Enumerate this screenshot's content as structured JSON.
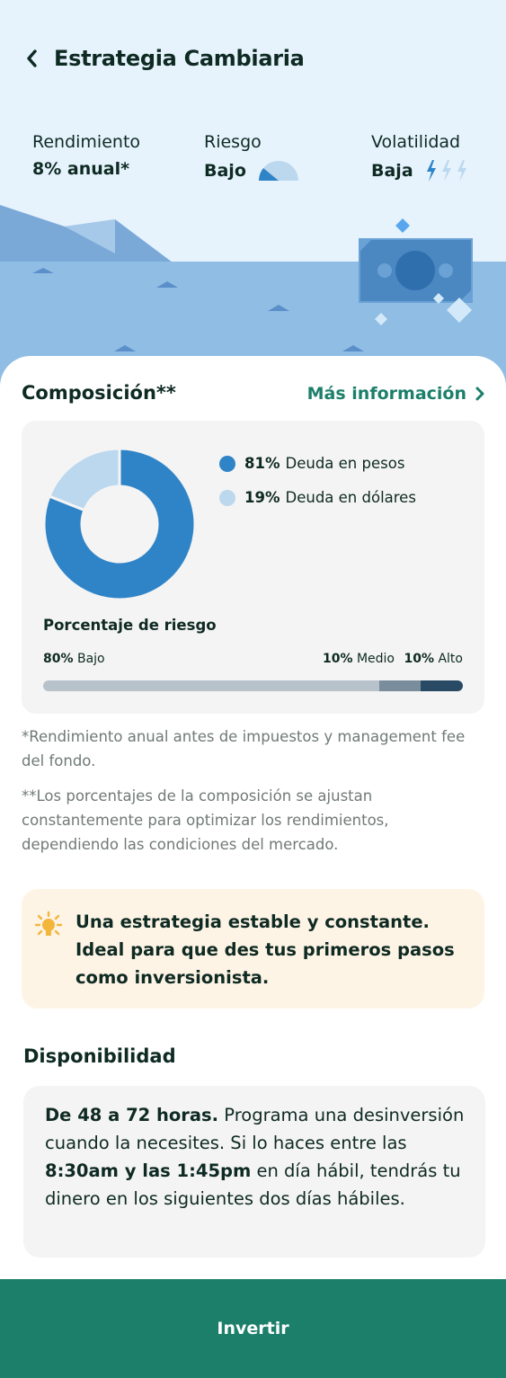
{
  "header": {
    "title": "Estrategia Cambiaria",
    "back_icon": "chevron-left-icon"
  },
  "stats": {
    "rendimiento": {
      "label": "Rendimiento",
      "value": "8% anual*"
    },
    "riesgo": {
      "label": "Riesgo",
      "value": "Bajo",
      "icon": "gauge-icon",
      "level": 0.33
    },
    "volatilidad": {
      "label": "Volatilidad",
      "value": "Baja",
      "icon": "lightning-icon",
      "level": "1 of 3"
    }
  },
  "composition": {
    "title": "Composición**",
    "more_info": "Más información",
    "more_icon": "chevron-right-icon",
    "items": [
      {
        "pct": "81%",
        "label": "Deuda en pesos",
        "value": 81,
        "color": "#2f84c8"
      },
      {
        "pct": "19%",
        "label": "Deuda en dólares",
        "value": 19,
        "color": "#bcd8ee"
      }
    ],
    "risk": {
      "title": "Porcentaje de riesgo",
      "low": {
        "pct": "80%",
        "label": "Bajo",
        "value": 80,
        "color": "#b7c2cb"
      },
      "mid": {
        "pct": "10%",
        "label": "Medio",
        "value": 10,
        "color": "#7a8d9c"
      },
      "high": {
        "pct": "10%",
        "label": "Alto",
        "value": 10,
        "color": "#294a65"
      }
    }
  },
  "notes": {
    "note1": "*Rendimiento anual antes de impuestos y management fee del fondo.",
    "note2": "**Los porcentajes de la composición se ajustan constantemente para optimizar los rendimientos, dependiendo las condiciones del mercado."
  },
  "tip": {
    "icon": "lightbulb-icon",
    "text": "Una estrategia estable y constante. Ideal para que des tus primeros pasos como inversionista."
  },
  "availability": {
    "title": "Disponibilidad",
    "bold1": "De 48 a 72 horas.",
    "text1": " Programa una desinversión cuando la necesites. Si lo haces entre las ",
    "bold2": "8:30am y las 1:45pm",
    "text2": " en día hábil, tendrás tu dinero en los siguientes dos días hábiles."
  },
  "cta": {
    "label": "Invertir"
  },
  "colors": {
    "accent": "#1c7f6a",
    "hero_bg": "#e6f3fd",
    "sea": "#8fbde3",
    "tip_bg": "#fef4e6"
  }
}
